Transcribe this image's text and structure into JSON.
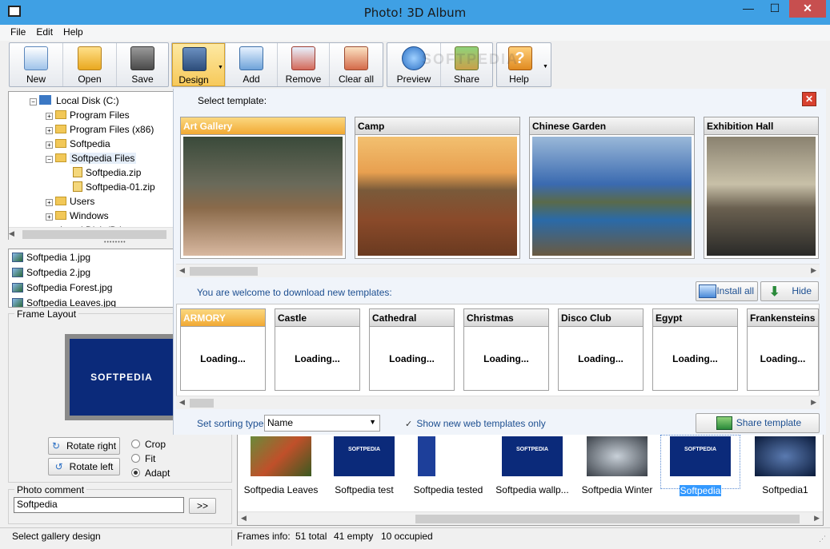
{
  "window": {
    "title": "Photo! 3D Album",
    "minimize": "—",
    "maximize": "☐",
    "close": "✕"
  },
  "menu": [
    "File",
    "Edit",
    "Help"
  ],
  "toolbar": {
    "new": "New",
    "open": "Open",
    "save": "Save",
    "design": "Design",
    "add": "Add",
    "remove": "Remove",
    "clear_all": "Clear all",
    "preview": "Preview",
    "share": "Share",
    "help": "Help"
  },
  "tree": {
    "root": "Local Disk (C:)",
    "items": [
      "Program Files",
      "Program Files (x86)",
      "Softpedia",
      "Softpedia Files",
      "Softpedia.zip",
      "Softpedia-01.zip",
      "Users",
      "Windows"
    ],
    "next": "Local Disk (D:)"
  },
  "files": [
    "Softpedia 1.jpg",
    "Softpedia 2.jpg",
    "Softpedia Forest.jpg",
    "Softpedia Leaves.jpg"
  ],
  "frame_layout": {
    "label": "Frame Layout",
    "preview_text": "SOFTPEDIA",
    "rotate_right": "Rotate right",
    "rotate_left": "Rotate left",
    "options": [
      "Crop",
      "Fit",
      "Adapt"
    ],
    "selected": "Adapt"
  },
  "photo_comment": {
    "label": "Photo comment",
    "value": "Softpedia",
    "button": ">>"
  },
  "popup": {
    "select_template": "Select template:",
    "templates": [
      "Art Gallery",
      "Camp",
      "Chinese Garden",
      "Exhibition Hall"
    ],
    "download_text": "You are welcome to download new templates:",
    "install_all": "Install all",
    "hide": "Hide",
    "web_templates": [
      "ARMORY",
      "Castle",
      "Cathedral",
      "Christmas",
      "Disco Club",
      "Egypt",
      "Frankensteins c"
    ],
    "loading": "Loading...",
    "sort_label": "Set sorting type:",
    "sort_value": "Name",
    "show_web_only": "Show new web templates only",
    "share_template": "Share template"
  },
  "thumbnails": [
    "Softpedia Leaves",
    "Softpedia test",
    "Softpedia tested",
    "Softpedia wallp...",
    "Softpedia Winter",
    "Softpedia",
    "Softpedia1"
  ],
  "thumb_label_text": "SOFTPEDIA",
  "watermark": "SOFTPEDIA",
  "status": {
    "left": "Select gallery design",
    "frames_info": "Frames info:",
    "total": "51 total",
    "empty": "41 empty",
    "occupied": "10 occupied"
  }
}
